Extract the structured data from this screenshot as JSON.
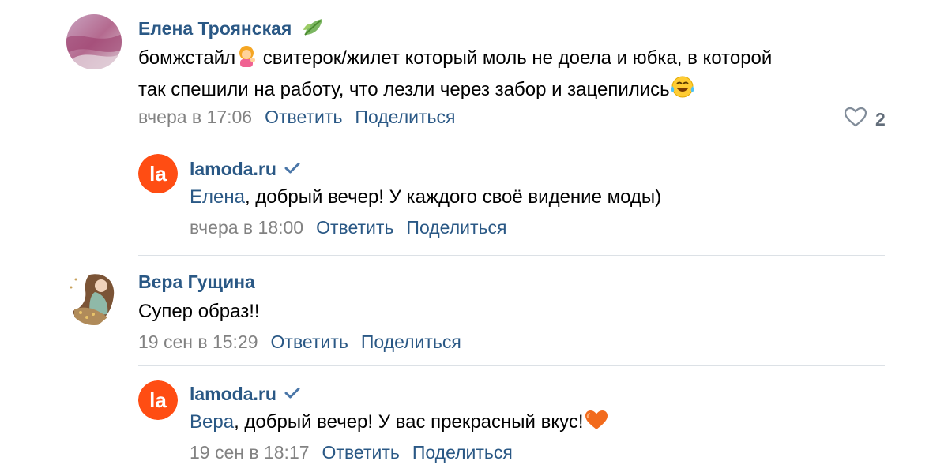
{
  "comments": [
    {
      "author": "Елена Троянская",
      "text_part1": "бомжстайл",
      "text_part2": " свитерок/жилет который моль не доела и юбка, в которой",
      "text_line2": "так спешили на работу, что лезли через забор и зацепились",
      "time": "вчера в 17:06",
      "reply_label": "Ответить",
      "share_label": "Поделиться",
      "likes": "2",
      "author_icon": "leaf-icon",
      "emoji1": "woman-tipping-hand-icon",
      "emoji2": "tears-of-joy-icon",
      "reply": {
        "author": "lamoda.ru",
        "mention": "Елена",
        "text": ", добрый вечер! У каждого своё видение моды)",
        "time": "вчера в 18:00",
        "reply_label": "Ответить",
        "share_label": "Поделиться",
        "logo_text": "la"
      }
    },
    {
      "author": "Вера Гущина",
      "text": "Супер образ!!",
      "time": "19 сен в 15:29",
      "reply_label": "Ответить",
      "share_label": "Поделиться",
      "reply": {
        "author": "lamoda.ru",
        "mention": "Вера",
        "text": ", добрый вечер! У вас прекрасный вкус!",
        "time": "19 сен в 18:17",
        "reply_label": "Ответить",
        "share_label": "Поделиться",
        "logo_text": "la",
        "emoji": "orange-heart-icon"
      }
    }
  ],
  "colors": {
    "link": "#2a5885",
    "meta": "#828282",
    "lamoda": "#ff4d13",
    "divider": "#dce1e6"
  }
}
